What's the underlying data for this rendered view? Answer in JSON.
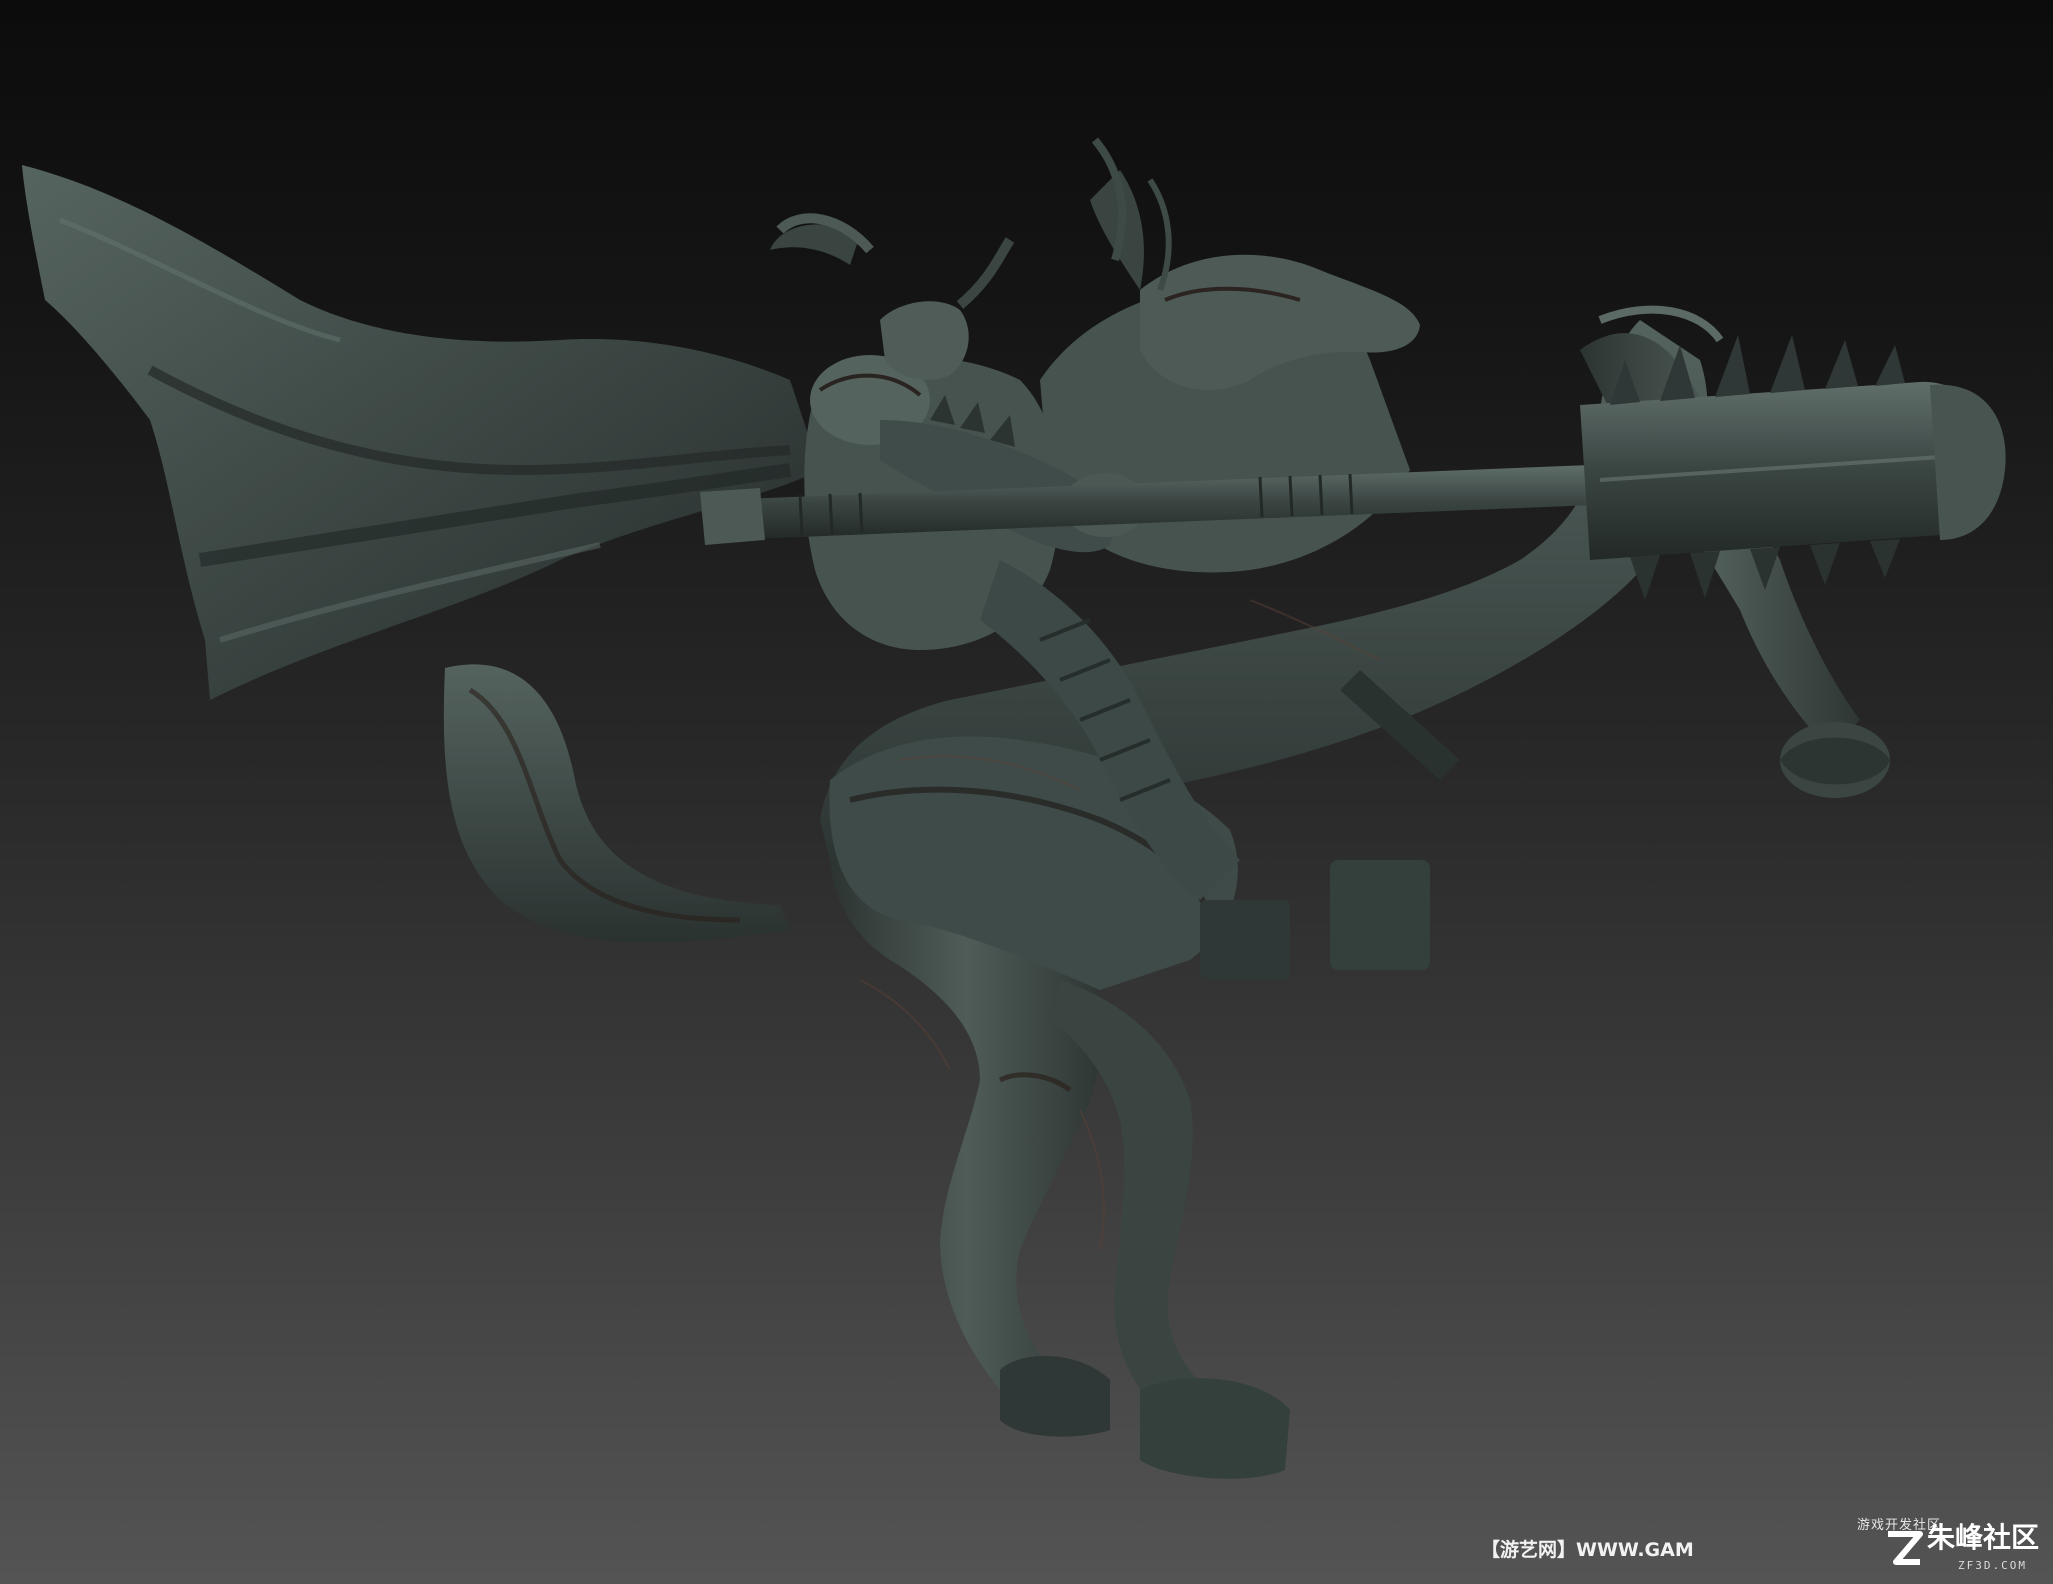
{
  "image": {
    "subject": "sculpted armored rider on rearing horse",
    "palette": {
      "background_top": "#0c0c0c",
      "background_bottom": "#545454",
      "sculpt_base": "#3f4b48",
      "sculpt_light": "#6c7c77",
      "sculpt_shadow": "#1f2523",
      "cavity": "#5a3f35"
    }
  },
  "watermark": {
    "top_text": "游戏开发社区",
    "left_text": "【游艺网】WWW.GAM",
    "brand": "朱峰社区",
    "sub": "ZF3D.COM",
    "logo_icon": "zf-logo-icon"
  }
}
